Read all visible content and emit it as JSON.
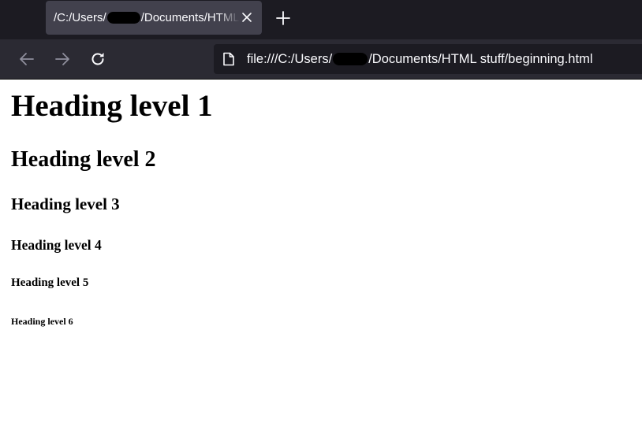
{
  "tab": {
    "title_prefix": "/C:/Users/",
    "title_suffix": "/Documents/HTML%"
  },
  "url": {
    "prefix": "file:///C:/Users/",
    "suffix": "/Documents/HTML stuff/beginning.html"
  },
  "icons": {
    "tab_close": "close-icon",
    "new_tab": "plus-icon",
    "back": "arrow-left-icon",
    "forward": "arrow-right-icon",
    "reload": "reload-icon",
    "page": "file-icon"
  },
  "headings": {
    "h1": "Heading level 1",
    "h2": "Heading level 2",
    "h3": "Heading level 3",
    "h4": "Heading level 4",
    "h5": "Heading level 5",
    "h6": "Heading level 6"
  },
  "colors": {
    "tabstrip_bg": "#1c1b22",
    "tab_selected_bg": "#42414d",
    "toolbar_bg": "#2b2a33",
    "urlbar_bg": "#1c1b22",
    "text_light": "#fbfbfe",
    "nav_disabled": "#8f8f9d",
    "page_bg": "#ffffff"
  }
}
